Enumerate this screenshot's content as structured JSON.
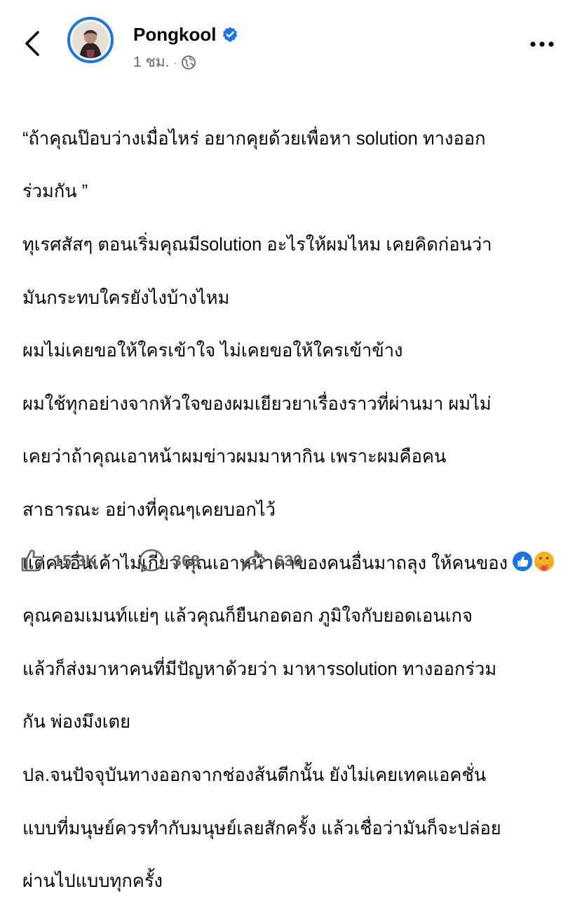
{
  "header": {
    "author_name": "Pongkool",
    "verified": true,
    "time": "1 ชม.",
    "separator": "·",
    "privacy_icon": "globe-icon",
    "back_icon": "chevron-left-icon",
    "more_icon": "more-horizontal-icon"
  },
  "post": {
    "lines": [
      "“ถ้าคุณป๊อบว่างเมื่อไหร่ อยากคุยด้วยเพื่อหา solution ทางออก",
      "ร่วมกัน ”",
      "ทุเรศสัสๆ ตอนเริ่มคุณมีsolution อะไรให้ผมไหม เคยคิดก่อนว่า",
      "มันกระทบใครยังไงบ้างไหม",
      "ผมไม่เคยขอให้ใครเข้าใจ ไม่เคยขอให้ใครเข้าข้าง",
      "ผมใช้ทุกอย่างจากหัวใจของผมเยียวยาเรื่องราวที่ผ่านมา  ผมไม่",
      "เคยว่าถ้าคุณเอาหน้าผมข่าวผมมาหากิน เพราะผมคือคน",
      "สาธารณะ อย่างที่คุณๆเคยบอกไว้",
      "แต่คนอื่นเค้าไม่เกี่ยว คุณเอาหน้าตาของคนอื่นมาถลุง ให้คนของ",
      "คุณคอมเมนท์แย่ๆ แล้วคุณก็ยืนกอดอก ภูมิใจกับยอดเอนเกจ",
      "แล้วก็ส่งมาหาคนที่มีปัญหาด้วยว่า มาหารsolution ทางออกร่วม",
      "กัน พ่องมึงเตย",
      "ปล.จนปัจจุบันทางออกจากช่องส้นตีกนั้น ยังไม่เคยเทคแอคชั่น",
      "แบบที่มนุษย์ควรทำกับมนุษย์เลยสักครั้ง แล้วเชื่อว่ามันก็จะปล่อย",
      "ผ่านไปแบบทุกครั้ง"
    ]
  },
  "actions": {
    "like_count": "15.3K",
    "comment_count": "368",
    "share_count": "630",
    "like_icon": "thumbs-up-icon",
    "comment_icon": "comment-bubble-icon",
    "share_icon": "share-arrow-icon",
    "reaction_icons": [
      "like-reaction-icon",
      "care-reaction-icon"
    ]
  },
  "colors": {
    "accent": "#1b74e4",
    "text": "#050505",
    "secondary_text": "#65676b",
    "care_yellow": "#f7b125",
    "care_heart": "#f33e58"
  }
}
